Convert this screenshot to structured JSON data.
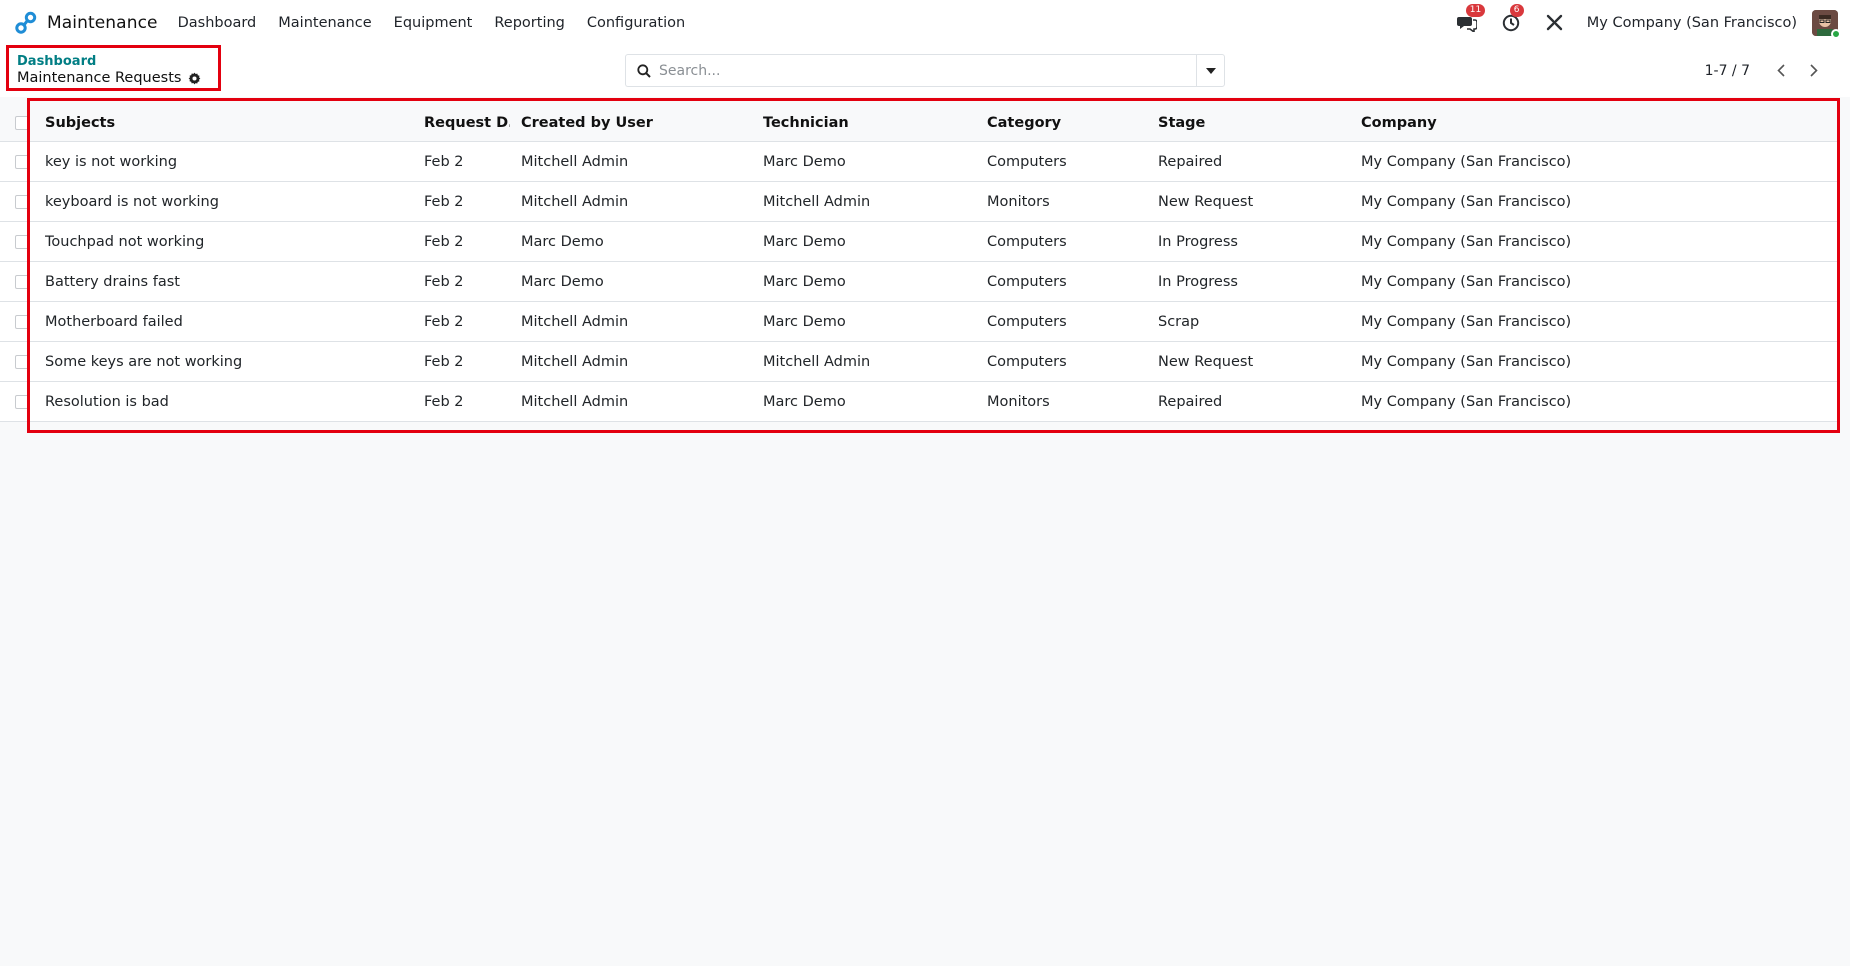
{
  "app": {
    "name": "Maintenance",
    "menu": [
      "Dashboard",
      "Maintenance",
      "Equipment",
      "Reporting",
      "Configuration"
    ],
    "logo_icon": "wrench-link-icon",
    "accent_color": "#1f8dd6"
  },
  "systray": {
    "messages_badge": "11",
    "activities_badge": "6",
    "company": "My Company (San Francisco)"
  },
  "breadcrumb": {
    "parent": "Dashboard",
    "current": "Maintenance Requests"
  },
  "search": {
    "placeholder": "Search..."
  },
  "pager": {
    "value": "1-7 / 7"
  },
  "table": {
    "columns": [
      "Subjects",
      "Request D...",
      "Created by User",
      "Technician",
      "Category",
      "Stage",
      "Company"
    ],
    "rows": [
      [
        "key is not working",
        "Feb 2",
        "Mitchell Admin",
        "Marc Demo",
        "Computers",
        "Repaired",
        "My Company (San Francisco)"
      ],
      [
        "keyboard is not working",
        "Feb 2",
        "Mitchell Admin",
        "Mitchell Admin",
        "Monitors",
        "New Request",
        "My Company (San Francisco)"
      ],
      [
        "Touchpad not working",
        "Feb 2",
        "Marc Demo",
        "Marc Demo",
        "Computers",
        "In Progress",
        "My Company (San Francisco)"
      ],
      [
        "Battery drains fast",
        "Feb 2",
        "Marc Demo",
        "Marc Demo",
        "Computers",
        "In Progress",
        "My Company (San Francisco)"
      ],
      [
        "Motherboard failed",
        "Feb 2",
        "Mitchell Admin",
        "Marc Demo",
        "Computers",
        "Scrap",
        "My Company (San Francisco)"
      ],
      [
        "Some keys are not working",
        "Feb 2",
        "Mitchell Admin",
        "Mitchell Admin",
        "Computers",
        "New Request",
        "My Company (San Francisco)"
      ],
      [
        "Resolution is bad",
        "Feb 2",
        "Mitchell Admin",
        "Marc Demo",
        "Monitors",
        "Repaired",
        "My Company (San Francisco)"
      ]
    ]
  }
}
